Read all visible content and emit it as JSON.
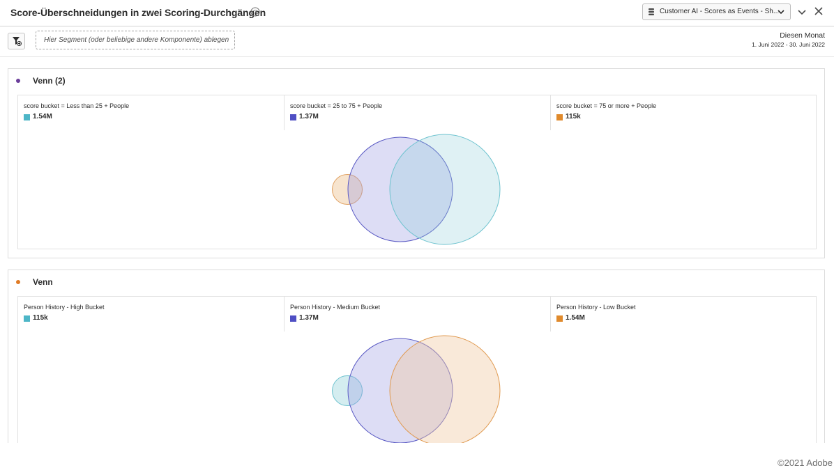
{
  "header": {
    "title": "Score-Überschneidungen in zwei Scoring-Durchgängen",
    "help_icon": "help-circle-icon",
    "data_source": "Customer AI - Scores as Events - Sh...",
    "collapse_icon": "chevron-down-icon",
    "close_icon": "close-icon"
  },
  "filterbar": {
    "filter_icon": "filter-add-icon",
    "segment_placeholder": "Hier Segment (oder beliebige andere Komponente) ablegen",
    "date_label": "Diesen Monat",
    "date_range": "1. Juni 2022 - 30. Juni 2022"
  },
  "colors": {
    "teal": "#5ab9c6",
    "blue": "#5454c6",
    "orange": "#e09138",
    "panel1_dot": "#6a3d9a",
    "panel2_dot": "#e07b25"
  },
  "panels": [
    {
      "title": "Venn (2)",
      "legend": [
        {
          "name": "score bucket = Less than 25 + People",
          "value": "1.54M",
          "color": "#4db6c7"
        },
        {
          "name": "score bucket = 25 to 75 + People",
          "value": "1.37M",
          "color": "#4f4fc4"
        },
        {
          "name": "score bucket = 75 or more + People",
          "value": "115k",
          "color": "#e08a2c"
        }
      ],
      "venn_sets": [
        {
          "set": "score bucket = Less than 25 + People",
          "people": 1540000
        },
        {
          "set": "score bucket = 25 to 75 + People",
          "people": 1370000
        },
        {
          "set": "score bucket = 75 or more + People",
          "people": 115000
        }
      ]
    },
    {
      "title": "Venn",
      "legend": [
        {
          "name": "Person History - High Bucket",
          "value": "115k",
          "color": "#4db6c7"
        },
        {
          "name": "Person History - Medium Bucket",
          "value": "1.37M",
          "color": "#4f4fc4"
        },
        {
          "name": "Person History - Low Bucket",
          "value": "1.54M",
          "color": "#e08a2c"
        }
      ],
      "venn_sets": [
        {
          "set": "Person History - High Bucket",
          "people": 115000
        },
        {
          "set": "Person History - Medium Bucket",
          "people": 1370000
        },
        {
          "set": "Person History - Low Bucket",
          "people": 1540000
        }
      ]
    }
  ],
  "footer": {
    "copyright": "©2021 Adobe"
  }
}
